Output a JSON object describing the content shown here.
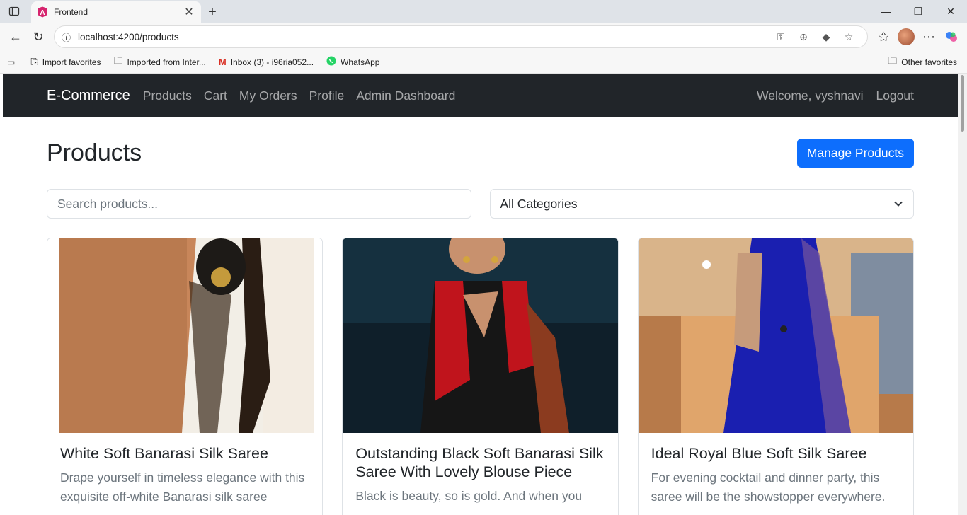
{
  "browser": {
    "tab_title": "Frontend",
    "url": "localhost:4200/products",
    "bookmarks": [
      "Import favorites",
      "Imported from Inter...",
      "Inbox (3) - i96ria052...",
      "WhatsApp"
    ],
    "other_favorites": "Other favorites"
  },
  "navbar": {
    "brand": "E-Commerce",
    "links": [
      "Products",
      "Cart",
      "My Orders",
      "Profile",
      "Admin Dashboard"
    ],
    "welcome": "Welcome, vyshnavi",
    "logout": "Logout"
  },
  "main": {
    "title": "Products",
    "manage_button": "Manage Products",
    "search_placeholder": "Search products...",
    "category_selected": "All Categories"
  },
  "products": [
    {
      "title": "White Soft Banarasi Silk Saree",
      "description": "Drape yourself in timeless elegance with this exquisite off-white Banarasi silk saree"
    },
    {
      "title": "Outstanding Black Soft Banarasi Silk Saree With Lovely Blouse Piece",
      "description": "Black is beauty, so is gold. And when you"
    },
    {
      "title": "Ideal Royal Blue Soft Silk Saree",
      "description": "For evening cocktail and dinner party, this saree will be the showstopper everywhere."
    }
  ],
  "colors": {
    "navbar_bg": "#212529",
    "primary": "#0d6efd"
  }
}
